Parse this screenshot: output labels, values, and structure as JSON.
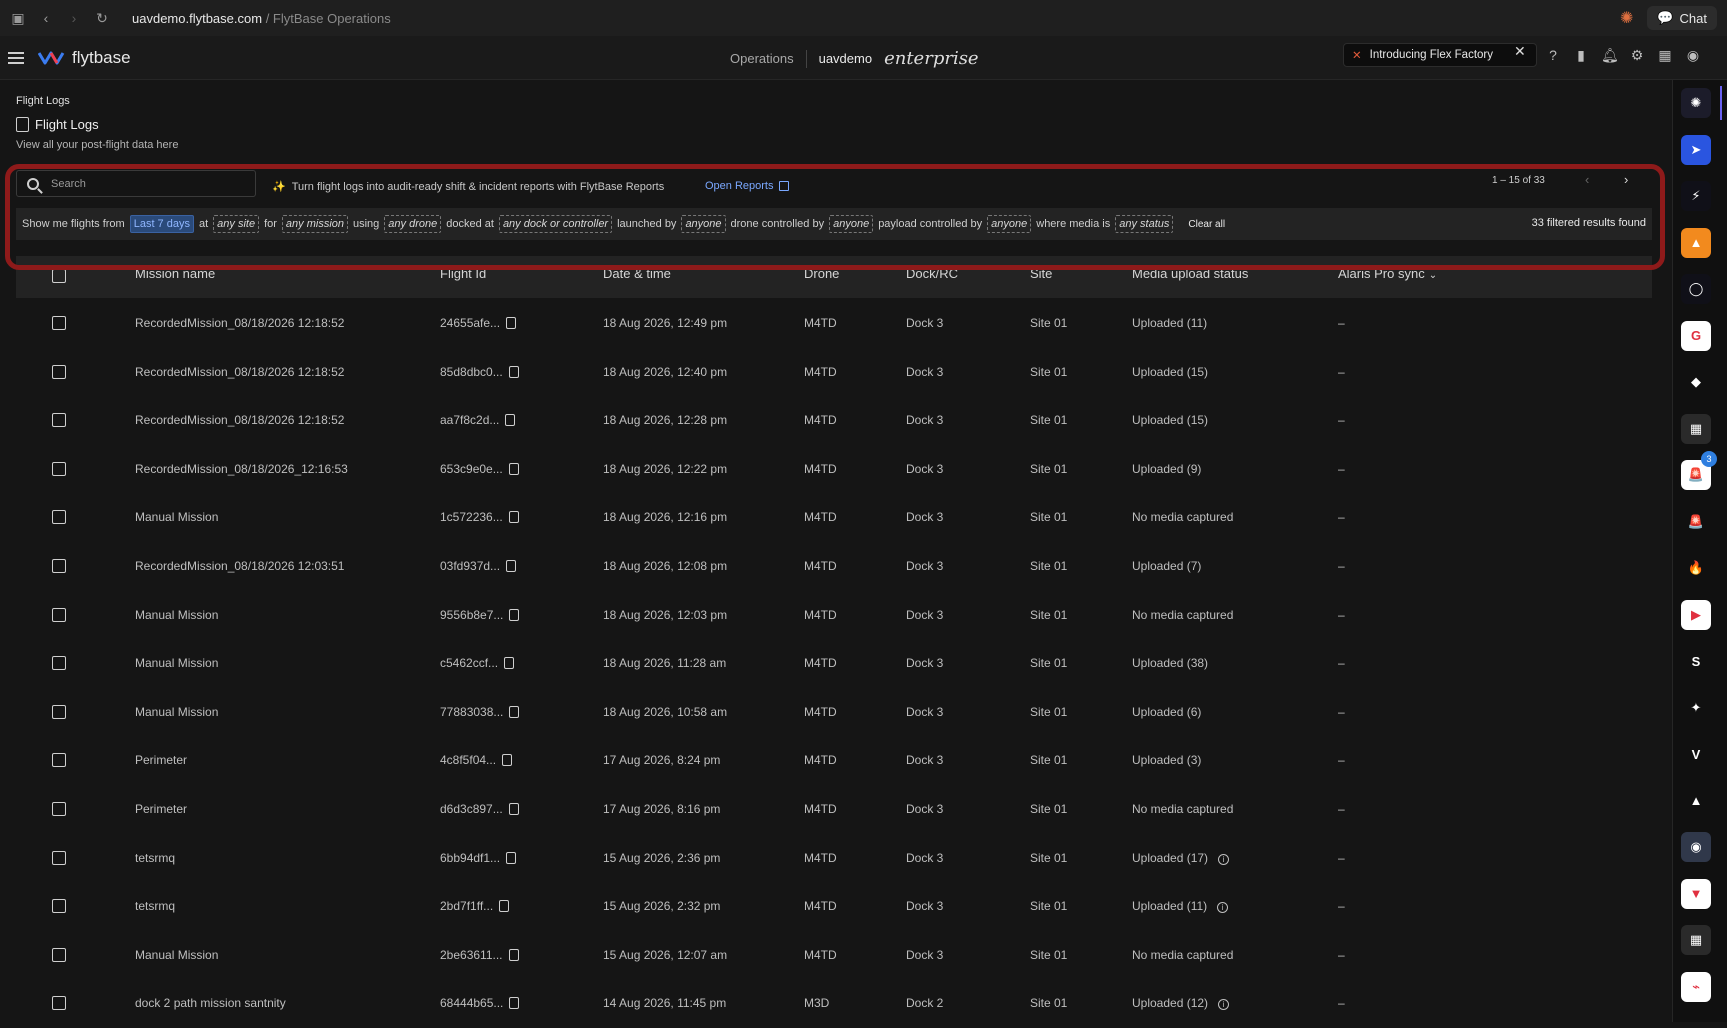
{
  "browser": {
    "url_host": "uavdemo.flytbase.com",
    "url_path": " / FlytBase Operations",
    "chat_label": "Chat"
  },
  "header": {
    "logo_text": "flytbase",
    "nav_operations": "Operations",
    "org_name": "uavdemo",
    "plan": "enterprise",
    "banner_text": "Introducing Flex Factory"
  },
  "page": {
    "breadcrumb": "Flight Logs",
    "title": "Flight Logs",
    "subtitle": "View all your post-flight data here"
  },
  "search": {
    "placeholder": "Search"
  },
  "reports": {
    "message": "Turn flight logs into audit-ready shift & incident reports with FlytBase Reports",
    "link": "Open Reports"
  },
  "pagination": {
    "range": "1 – 15 of 33"
  },
  "filters": {
    "t1": "Show me flights from",
    "date_range": "Last 7 days",
    "t2": "at",
    "site": "any site",
    "t3": "for",
    "mission": "any mission",
    "t4": "using",
    "drone": "any drone",
    "t5": "docked at",
    "dock": "any dock or controller",
    "t6": "launched by",
    "launcher": "anyone",
    "t7": "drone controlled by",
    "drone_controller": "anyone",
    "t8": "payload controlled by",
    "payload_controller": "anyone",
    "t9": "where media is",
    "media": "any status",
    "clear_all": "Clear all",
    "results": "33 filtered results found"
  },
  "table": {
    "columns": [
      "Mission name",
      "Flight Id",
      "Date & time",
      "Drone",
      "Dock/RC",
      "Site",
      "Media upload status",
      "Alaris Pro sync"
    ],
    "rows": [
      {
        "mission": "RecordedMission_08/18/2026 12:18:52",
        "flight_id": "24655afe...",
        "datetime": "18 Aug 2026, 12:49 pm",
        "drone": "M4TD",
        "dock": "Dock 3",
        "site": "Site 01",
        "media": "Uploaded (11)",
        "info": false,
        "sync": "–"
      },
      {
        "mission": "RecordedMission_08/18/2026 12:18:52",
        "flight_id": "85d8dbc0...",
        "datetime": "18 Aug 2026, 12:40 pm",
        "drone": "M4TD",
        "dock": "Dock 3",
        "site": "Site 01",
        "media": "Uploaded (15)",
        "info": false,
        "sync": "–"
      },
      {
        "mission": "RecordedMission_08/18/2026 12:18:52",
        "flight_id": "aa7f8c2d...",
        "datetime": "18 Aug 2026, 12:28 pm",
        "drone": "M4TD",
        "dock": "Dock 3",
        "site": "Site 01",
        "media": "Uploaded (15)",
        "info": false,
        "sync": "–"
      },
      {
        "mission": "RecordedMission_08/18/2026_12:16:53",
        "flight_id": "653c9e0e...",
        "datetime": "18 Aug 2026, 12:22 pm",
        "drone": "M4TD",
        "dock": "Dock 3",
        "site": "Site 01",
        "media": "Uploaded (9)",
        "info": false,
        "sync": "–"
      },
      {
        "mission": "Manual Mission",
        "flight_id": "1c572236...",
        "datetime": "18 Aug 2026, 12:16 pm",
        "drone": "M4TD",
        "dock": "Dock 3",
        "site": "Site 01",
        "media": "No media captured",
        "info": false,
        "sync": "–"
      },
      {
        "mission": "RecordedMission_08/18/2026 12:03:51",
        "flight_id": "03fd937d...",
        "datetime": "18 Aug 2026, 12:08 pm",
        "drone": "M4TD",
        "dock": "Dock 3",
        "site": "Site 01",
        "media": "Uploaded (7)",
        "info": false,
        "sync": "–"
      },
      {
        "mission": "Manual Mission",
        "flight_id": "9556b8e7...",
        "datetime": "18 Aug 2026, 12:03 pm",
        "drone": "M4TD",
        "dock": "Dock 3",
        "site": "Site 01",
        "media": "No media captured",
        "info": false,
        "sync": "–"
      },
      {
        "mission": "Manual Mission",
        "flight_id": "c5462ccf...",
        "datetime": "18 Aug 2026, 11:28 am",
        "drone": "M4TD",
        "dock": "Dock 3",
        "site": "Site 01",
        "media": "Uploaded (38)",
        "info": false,
        "sync": "–"
      },
      {
        "mission": "Manual Mission",
        "flight_id": "77883038...",
        "datetime": "18 Aug 2026, 10:58 am",
        "drone": "M4TD",
        "dock": "Dock 3",
        "site": "Site 01",
        "media": "Uploaded (6)",
        "info": false,
        "sync": "–"
      },
      {
        "mission": "Perimeter",
        "flight_id": "4c8f5f04...",
        "datetime": "17 Aug 2026, 8:24 pm",
        "drone": "M4TD",
        "dock": "Dock 3",
        "site": "Site 01",
        "media": "Uploaded (3)",
        "info": false,
        "sync": "–"
      },
      {
        "mission": "Perimeter",
        "flight_id": "d6d3c897...",
        "datetime": "17 Aug 2026, 8:16 pm",
        "drone": "M4TD",
        "dock": "Dock 3",
        "site": "Site 01",
        "media": "No media captured",
        "info": false,
        "sync": "–"
      },
      {
        "mission": "tetsrmq",
        "flight_id": "6bb94df1...",
        "datetime": "15 Aug 2026, 2:36 pm",
        "drone": "M4TD",
        "dock": "Dock 3",
        "site": "Site 01",
        "media": "Uploaded (17)",
        "info": true,
        "sync": "–"
      },
      {
        "mission": "tetsrmq",
        "flight_id": "2bd7f1ff...",
        "datetime": "15 Aug 2026, 2:32 pm",
        "drone": "M4TD",
        "dock": "Dock 3",
        "site": "Site 01",
        "media": "Uploaded (11)",
        "info": true,
        "sync": "–"
      },
      {
        "mission": "Manual Mission",
        "flight_id": "2be63611...",
        "datetime": "15 Aug 2026, 12:07 am",
        "drone": "M4TD",
        "dock": "Dock 3",
        "site": "Site 01",
        "media": "No media captured",
        "info": false,
        "sync": "–"
      },
      {
        "mission": "dock 2 path mission santnity",
        "flight_id": "68444b65...",
        "datetime": "14 Aug 2026, 11:45 pm",
        "drone": "M3D",
        "dock": "Dock 2",
        "site": "Site 01",
        "media": "Uploaded (12)",
        "info": true,
        "sync": "–"
      }
    ]
  },
  "rail": {
    "badge_count": "3",
    "apps": [
      {
        "name": "ai-app-icon",
        "color": "#1c1c2a",
        "glyph": "✺"
      },
      {
        "name": "send-app-icon",
        "color": "#2a55e0",
        "glyph": "➤"
      },
      {
        "name": "flow-app-icon",
        "color": "#101018",
        "glyph": "⚡"
      },
      {
        "name": "orange-app-icon",
        "color": "#f28a1e",
        "glyph": "▲"
      },
      {
        "name": "ring-app-icon",
        "color": "#101018",
        "glyph": "◯"
      },
      {
        "name": "genetec-app-icon",
        "color": "#ffffff",
        "glyph": "G"
      },
      {
        "name": "diamond-app-icon",
        "color": "#101010",
        "glyph": "◆"
      },
      {
        "name": "grid-app-icon",
        "color": "#2a2a2a",
        "glyph": "▦"
      },
      {
        "name": "alarm-app-icon",
        "color": "#ffffff",
        "glyph": "🚨"
      },
      {
        "name": "siren-app-icon",
        "color": "#101010",
        "glyph": "🚨"
      },
      {
        "name": "fire-app-icon",
        "color": "#101010",
        "glyph": "🔥"
      },
      {
        "name": "camera-app-icon",
        "color": "#ffffff",
        "glyph": "▶"
      },
      {
        "name": "s-app-icon",
        "color": "#101010",
        "glyph": "S"
      },
      {
        "name": "gallery-app-icon",
        "color": "#101010",
        "glyph": "✦"
      },
      {
        "name": "v-app-icon",
        "color": "#101010",
        "glyph": "V"
      },
      {
        "name": "peak-app-icon",
        "color": "#101010",
        "glyph": "▲"
      },
      {
        "name": "scanner-app-icon",
        "color": "#30384a",
        "glyph": "◉"
      },
      {
        "name": "drone-app-icon",
        "color": "#ffffff",
        "glyph": "▼"
      },
      {
        "name": "grid2-app-icon",
        "color": "#2a2a2a",
        "glyph": "▦"
      },
      {
        "name": "cctv-app-icon",
        "color": "#ffffff",
        "glyph": "⌁"
      }
    ]
  },
  "colors": {
    "accent_blue": "#7aa8ff",
    "highlight_red": "#8e1a1a",
    "background": "#151515"
  }
}
